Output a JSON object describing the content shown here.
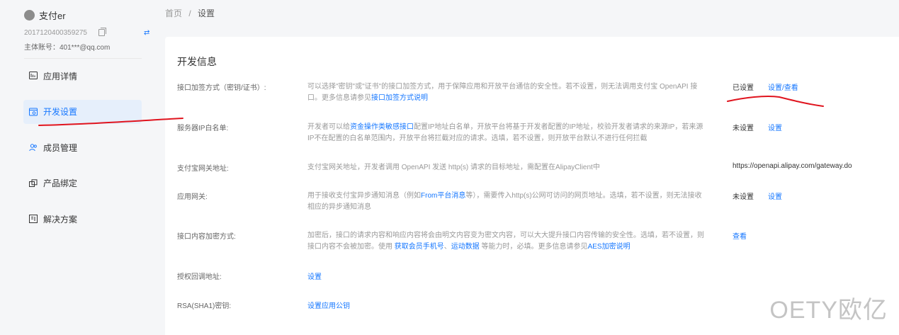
{
  "app": {
    "name": "支付er",
    "id": "2017120400359275",
    "account": "主体账号：401***@qq.com"
  },
  "sidebar": {
    "items": [
      {
        "label": "应用详情",
        "icon": "app-detail-icon"
      },
      {
        "label": "开发设置",
        "icon": "dev-settings-icon",
        "active": true
      },
      {
        "label": "成员管理",
        "icon": "members-icon"
      },
      {
        "label": "产品绑定",
        "icon": "product-bind-icon"
      },
      {
        "label": "解决方案",
        "icon": "solution-icon"
      }
    ]
  },
  "breadcrumb": {
    "home": "首页",
    "separator": "/",
    "current": "设置"
  },
  "section": {
    "title": "开发信息"
  },
  "rows": {
    "encrypt": {
      "label": "接口加签方式（密钥/证书）:",
      "desc_text": "可以选择\"密钥\"或\"证书\"的接口加签方式，用于保障应用和开放平台通信的安全性。若不设置，则无法调用支付宝 OpenAPI 接口。更多信息请参见",
      "desc_link": "接口加签方式说明",
      "status": "已设置",
      "action": "设置/查看"
    },
    "whitelist": {
      "label": "服务器IP白名单:",
      "desc_pre": "开发者可以给",
      "desc_link": "资金操作类敏感接口",
      "desc_post": "配置IP地址白名单，开放平台将基于开发者配置的IP地址，校验开发者请求的来源IP，若来源IP不在配置的白名单范围内，开放平台将拦截对应的请求。选填，若不设置，则开放平台默认不进行任何拦截",
      "status": "未设置",
      "action": "设置"
    },
    "gateway": {
      "label": "支付宝网关地址:",
      "desc": "支付宝网关地址，开发者调用 OpenAPI 发送 http(s) 请求的目标地址，需配置在AlipayClient中",
      "value": "https://openapi.alipay.com/gateway.do"
    },
    "app_gateway": {
      "label": "应用网关:",
      "desc_pre": "用于接收支付宝异步通知消息（例如",
      "desc_link": "From平台消息",
      "desc_post": "等），需要传入http(s)公网可访问的网页地址。选填，若不设置，则无法接收相应的异步通知消息",
      "status": "未设置",
      "action": "设置"
    },
    "content_encrypt": {
      "label": "接口内容加密方式:",
      "desc_pre": "加密后，接口的请求内容和响应内容将会由明文内容变为密文内容，可以大大提升接口内容传输的安全性。选填，若不设置，则接口内容不会被加密。使用 ",
      "desc_link1": "获取会员手机号",
      "desc_sep": "、",
      "desc_link2": "运动数据",
      "desc_mid": " 等能力时，必填。更多信息请参见",
      "desc_link3": "AES加密说明",
      "action": "查看"
    },
    "auth_callback": {
      "label": "授权回调地址:",
      "action": "设置"
    },
    "rsa": {
      "label": "RSA(SHA1)密钥:",
      "action": "设置应用公钥"
    }
  },
  "watermark": "OETY欧亿",
  "colors": {
    "accent": "#1677ff",
    "annotation": "#e0141e"
  }
}
